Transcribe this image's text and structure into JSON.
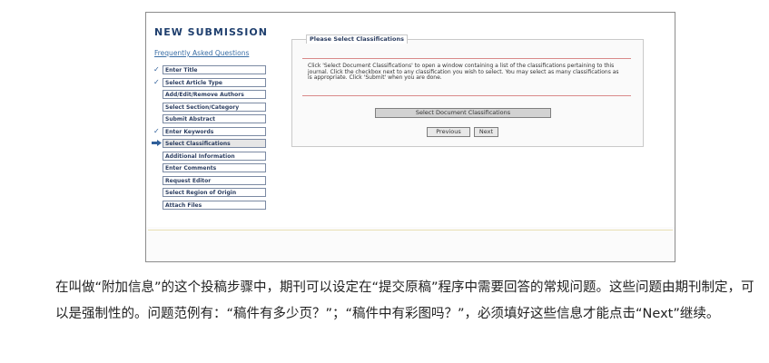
{
  "app": {
    "title": "NEW SUBMISSION",
    "faq_link": "Frequently Asked Questions"
  },
  "steps": [
    {
      "label": "Enter Title",
      "status": "done"
    },
    {
      "label": "Select Article Type",
      "status": "done"
    },
    {
      "label": "Add/Edit/Remove Authors",
      "status": "pending"
    },
    {
      "label": "Select Section/Category",
      "status": "pending"
    },
    {
      "label": "Submit Abstract",
      "status": "pending"
    },
    {
      "label": "Enter Keywords",
      "status": "done"
    },
    {
      "label": "Select Classifications",
      "status": "current"
    },
    {
      "label": "Additional Information",
      "status": "pending"
    },
    {
      "label": "Enter Comments",
      "status": "pending"
    },
    {
      "label": "Request Editor",
      "status": "pending"
    },
    {
      "label": "Select Region of Origin",
      "status": "pending"
    },
    {
      "label": "Attach Files",
      "status": "pending"
    }
  ],
  "panel": {
    "heading": "Please Select Classifications",
    "instructions": "Click 'Select Document Classifications' to open a window containing a list of the classifications pertaining to this journal. Click the checkbox next to any classification you wish to select. You may select as many classifications as is appropriate. Click 'Submit' when you are done.",
    "select_button": "Select Document Classifications",
    "previous_button": "Previous",
    "next_button": "Next"
  },
  "caption": "在叫做“附加信息”的这个投稿步骤中，期刊可以设定在“提交原稿”程序中需要回答的常规问题。这些问题由期刊制定，可以是强制性的。问题范例有：“稿件有多少页？”；“稿件中有彩图吗？”，必须填好这些信息才能点击“Next”继续。",
  "icons": {
    "done": "check-icon",
    "current": "arrow-right-icon"
  },
  "colors": {
    "title": "#1f3f6e",
    "link": "#3a6ea5",
    "rule": "#d98a8a"
  }
}
